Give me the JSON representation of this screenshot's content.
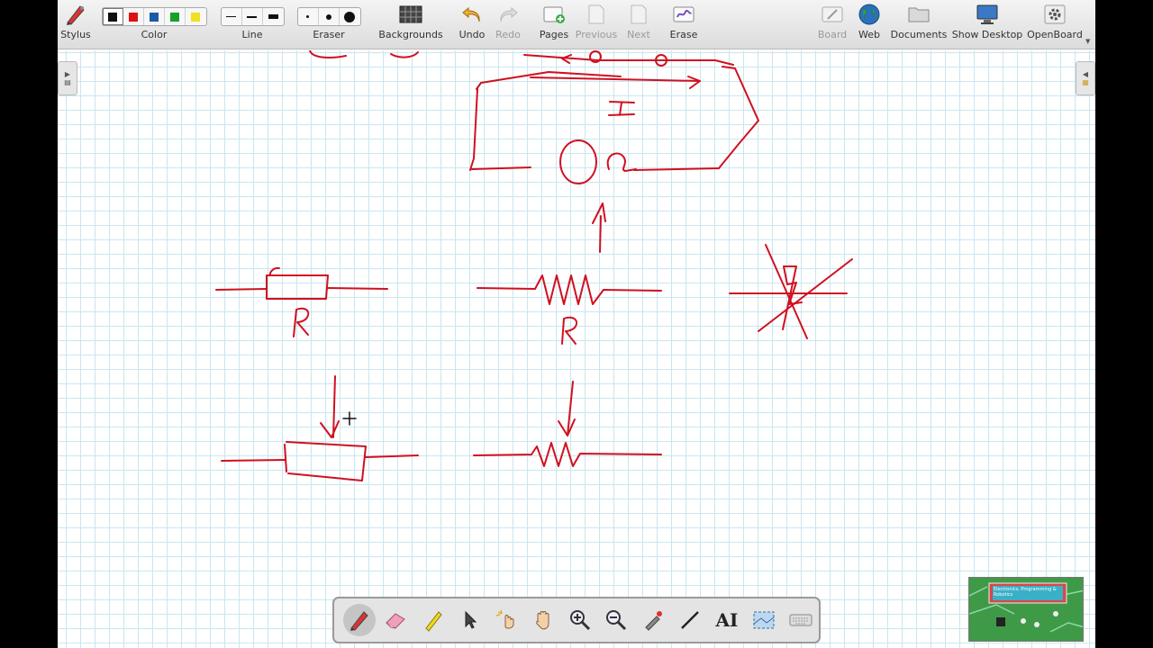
{
  "toolbar": {
    "stylus_label": "Stylus",
    "color_label": "Color",
    "line_label": "Line",
    "eraser_label": "Eraser",
    "backgrounds_label": "Backgrounds",
    "undo_label": "Undo",
    "redo_label": "Redo",
    "pages_label": "Pages",
    "previous_label": "Previous",
    "next_label": "Next",
    "erase_label": "Erase",
    "board_label": "Board",
    "web_label": "Web",
    "documents_label": "Documents",
    "show_desktop_label": "Show Desktop",
    "openboard_label": "OpenBoard"
  },
  "colors": {
    "black": "#111111",
    "red": "#dd1111",
    "blue": "#1a5aa8",
    "green": "#18a028",
    "yellow": "#f0e020",
    "ink": "#d01020",
    "grid": "#c9e6f0"
  },
  "canvas": {
    "text_current": "I",
    "text_resistance": "0Ω",
    "text_r1": "R",
    "text_r2": "R"
  },
  "thumbnail": {
    "title": "Electronics, Programming & Robotics"
  },
  "stylus_palette": {
    "tools": [
      "pen-icon",
      "eraser-icon",
      "highlighter-icon",
      "selector-icon",
      "interactive-pointer-icon",
      "hand-icon",
      "zoom-in-icon",
      "zoom-out-icon",
      "laser-pointer-icon",
      "line-icon",
      "text-icon",
      "capture-icon",
      "keyboard-icon"
    ],
    "text_tool_label": "AI"
  }
}
